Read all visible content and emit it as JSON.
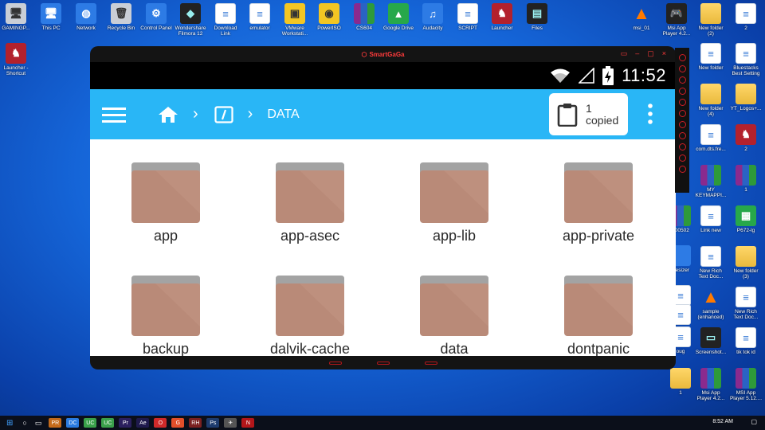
{
  "desktop": {
    "top_icons": [
      {
        "label": "GAMINGP...",
        "icon": "computer-icon",
        "style": "grey",
        "glyph": "🖥"
      },
      {
        "label": "This PC",
        "icon": "this-pc-icon",
        "style": "blue",
        "glyph": "🖥"
      },
      {
        "label": "Network",
        "icon": "network-icon",
        "style": "blue",
        "glyph": "◍"
      },
      {
        "label": "Recycle Bin",
        "icon": "recycle-bin-icon",
        "style": "grey",
        "glyph": "🗑"
      },
      {
        "label": "Control Panel",
        "icon": "control-panel-icon",
        "style": "blue",
        "glyph": "⚙"
      },
      {
        "label": "Wondershare\nFilmora 12",
        "icon": "filmora-icon",
        "style": "dark",
        "glyph": "◆"
      },
      {
        "label": "Download\nLink",
        "icon": "document-icon",
        "style": "doc",
        "glyph": "≡"
      },
      {
        "label": "emulator",
        "icon": "document-icon",
        "style": "doc",
        "glyph": "≡"
      },
      {
        "label": "VMware\nWorkstati...",
        "icon": "vmware-icon",
        "style": "yellow",
        "glyph": "▣"
      },
      {
        "label": "PowerISO",
        "icon": "poweriso-icon",
        "style": "yellow",
        "glyph": "◉"
      },
      {
        "label": "CS604",
        "icon": "winrar-icon",
        "style": "winrar",
        "glyph": ""
      },
      {
        "label": "Google Drive",
        "icon": "google-drive-icon",
        "style": "green",
        "glyph": "▲"
      },
      {
        "label": "Audacity",
        "icon": "audacity-icon",
        "style": "blue",
        "glyph": "♫"
      },
      {
        "label": "SCRIPT",
        "icon": "document-icon",
        "style": "doc",
        "glyph": "≡"
      },
      {
        "label": "Launcher",
        "icon": "launcher-icon",
        "style": "red",
        "glyph": "♞"
      },
      {
        "label": "Files",
        "icon": "files-icon",
        "style": "dark",
        "glyph": "▤"
      },
      {
        "label": "msi_01",
        "icon": "vlc-icon",
        "style": "cone",
        "glyph": "▲"
      },
      {
        "label": "Msi App\nPlayer 4.2...",
        "icon": "msi-app-player-icon",
        "style": "dark",
        "glyph": "🎮"
      },
      {
        "label": "New folder\n(2)",
        "icon": "folder-icon",
        "style": "folder",
        "glyph": ""
      },
      {
        "label": "2",
        "icon": "document-icon",
        "style": "doc",
        "glyph": "≡"
      }
    ],
    "left_icon": {
      "label": "Launcher -\nShortcut",
      "icon": "launcher-shortcut-icon"
    },
    "right_icons": [
      {
        "label": "New folder",
        "icon": "folder-icon",
        "style": "doc",
        "glyph": "≡"
      },
      {
        "label": "Bluestacks\nBest Setting",
        "icon": "document-icon",
        "style": "doc",
        "glyph": "≡"
      },
      {
        "label": "New folder\n(4)",
        "icon": "folder-icon",
        "style": "folder",
        "glyph": ""
      },
      {
        "label": "YT_Logos+...",
        "icon": "folder-icon",
        "style": "folder",
        "glyph": ""
      },
      {
        "label": "com.dts.fre...",
        "icon": "document-icon",
        "style": "doc",
        "glyph": "≡"
      },
      {
        "label": "2",
        "icon": "launcher-icon",
        "style": "red",
        "glyph": "♞"
      },
      {
        "label": "MY\nKEYMAPPI...",
        "icon": "winrar-icon",
        "style": "winrar",
        "glyph": ""
      },
      {
        "label": "1",
        "icon": "winrar-icon",
        "style": "winrar",
        "glyph": ""
      },
      {
        "label": "Link new",
        "icon": "document-icon",
        "style": "doc",
        "glyph": "≡"
      },
      {
        "label": "P672-lg",
        "icon": "image-icon",
        "style": "green",
        "glyph": "▦"
      },
      {
        "label": "New Rich\nText Doc...",
        "icon": "document-icon",
        "style": "doc",
        "glyph": "≡"
      },
      {
        "label": "New folder\n(3)",
        "icon": "folder-icon",
        "style": "folder",
        "glyph": ""
      },
      {
        "label": "sample\n(enhanced)",
        "icon": "vlc-icon",
        "style": "cone",
        "glyph": "▲"
      },
      {
        "label": "New Rich\nText Doc...",
        "icon": "document-icon",
        "style": "doc",
        "glyph": "≡"
      },
      {
        "label": "Screenshot...",
        "icon": "screenshot-icon",
        "style": "dark",
        "glyph": "▭"
      },
      {
        "label": "tik tok id",
        "icon": "document-icon",
        "style": "doc",
        "glyph": "≡"
      },
      {
        "label": "Msi App\nPlayer 4.2...",
        "icon": "winrar-icon",
        "style": "winrar",
        "glyph": ""
      },
      {
        "label": "MSI App\nPlayer 5.12....",
        "icon": "winrar-icon",
        "style": "winrar",
        "glyph": ""
      }
    ],
    "partial_icons": [
      {
        "label": "200502",
        "icon": "winrar-icon"
      },
      {
        "label": "Resizer",
        "icon": "resizer-icon"
      },
      {
        "label": "Rich\nDoc...",
        "icon": "document-icon"
      },
      {
        "label": "Rich\nDoc...",
        "icon": "document-icon"
      },
      {
        "label": "oug",
        "icon": "document-icon"
      },
      {
        "label": "1",
        "icon": "folder-icon"
      }
    ]
  },
  "emulator": {
    "title": "SmartGaGa",
    "window_buttons": [
      "▭",
      "–",
      "▢",
      "×"
    ],
    "clock": "11:52",
    "breadcrumb": {
      "current": "DATA"
    },
    "clipboard": {
      "count": "1",
      "label": "copied"
    },
    "folders": [
      "app",
      "app-asec",
      "app-lib",
      "app-private",
      "backup",
      "dalvik-cache",
      "data",
      "dontpanic"
    ]
  },
  "taskbar": {
    "time": "8:52 AM",
    "items": [
      "PR",
      "DC",
      "UC",
      "UC",
      "Pr",
      "Ae",
      "O",
      "G",
      "RH",
      "Ps",
      "✈",
      "N"
    ]
  },
  "colors": {
    "appbar": "#29b6f6",
    "folder_body": "#b98a78",
    "folder_tab": "#a3a3a3",
    "accent_red": "#d21e26"
  }
}
